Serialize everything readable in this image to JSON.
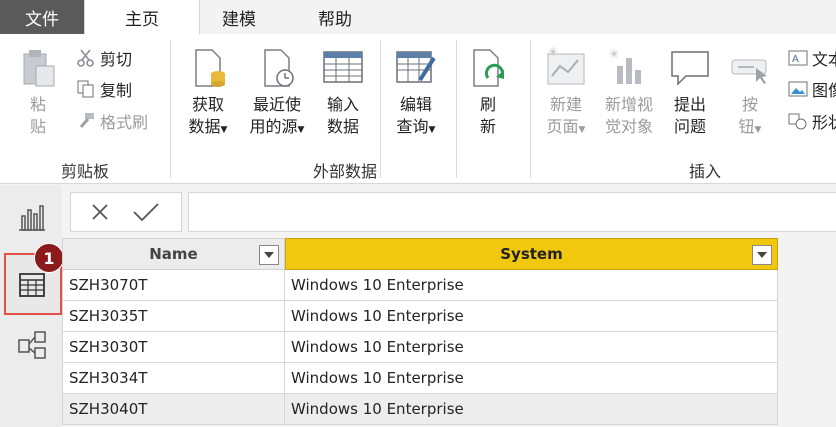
{
  "menu": {
    "file": "文件",
    "tabs": [
      "主页",
      "建模",
      "帮助"
    ]
  },
  "clipboard": {
    "paste": [
      "粘",
      "贴"
    ],
    "cut": "剪切",
    "copy": "复制",
    "format_painter": "格式刷",
    "group_label": "剪贴板"
  },
  "external_data": {
    "get_data": [
      "获取",
      "数据"
    ],
    "recent_sources": [
      "最近使",
      "用的源"
    ],
    "enter_data": [
      "输入",
      "数据"
    ],
    "edit_queries": [
      "编辑",
      "查询"
    ],
    "refresh": [
      "刷",
      "新"
    ],
    "group_label": "外部数据"
  },
  "insert": {
    "new_page": [
      "新建",
      "页面"
    ],
    "new_visual": [
      "新增视",
      "觉对象"
    ],
    "ask_question": [
      "提出",
      "问题"
    ],
    "buttons": [
      "按",
      "钮"
    ],
    "text_box": "文本",
    "image": "图像",
    "shapes": "形状",
    "group_label": "插入"
  },
  "nav": {
    "badge": "1"
  },
  "table": {
    "headers": [
      "Name",
      "System"
    ],
    "rows": [
      [
        "SZH3070T",
        "Windows 10 Enterprise"
      ],
      [
        "SZH3035T",
        "Windows 10 Enterprise"
      ],
      [
        "SZH3030T",
        "Windows 10 Enterprise"
      ],
      [
        "SZH3034T",
        "Windows 10 Enterprise"
      ],
      [
        "SZH3040T",
        "Windows 10 Enterprise"
      ]
    ]
  },
  "colors": {
    "selected_column": "#f2c80f",
    "file_tab": "#5a5a5a",
    "badge": "#8b1a1a",
    "highlight_border": "#e2524a"
  }
}
